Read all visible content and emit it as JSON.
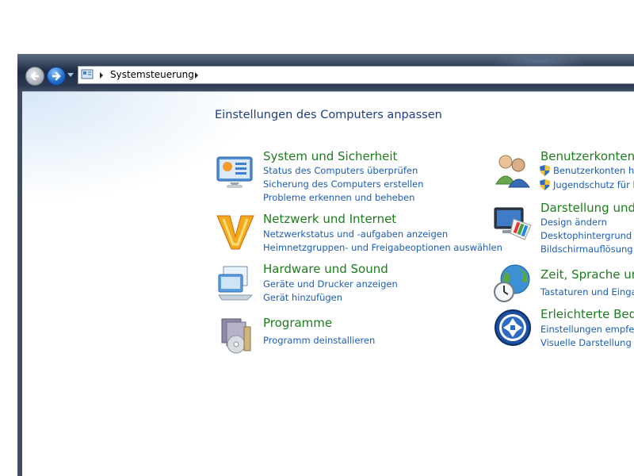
{
  "address": {
    "crumb": "Systemsteuerung"
  },
  "page": {
    "title": "Einstellungen des Computers anpassen"
  },
  "left": [
    {
      "title": "System und Sicherheit",
      "icon": "system-security-icon",
      "links": [
        "Status des Computers überprüfen",
        "Sicherung des Computers erstellen",
        "Probleme erkennen und beheben"
      ]
    },
    {
      "title": "Netzwerk und Internet",
      "icon": "network-internet-icon",
      "links": [
        "Netzwerkstatus und -aufgaben anzeigen",
        "Heimnetzgruppen- und Freigabeoptionen auswählen"
      ]
    },
    {
      "title": "Hardware und Sound",
      "icon": "hardware-sound-icon",
      "links": [
        "Geräte und Drucker anzeigen",
        "Gerät hinzufügen"
      ]
    },
    {
      "title": "Programme",
      "icon": "programs-icon",
      "links": [
        "Programm deinstallieren"
      ]
    }
  ],
  "right": [
    {
      "title": "Benutzerkonten u",
      "icon": "user-accounts-icon",
      "links": [
        "Benutzerkonten hin",
        "Jugendschutz für be"
      ]
    },
    {
      "title": "Darstellung und A",
      "icon": "appearance-icon",
      "links": [
        "Design ändern",
        "Desktophintergrund än",
        "Bildschirmauflösung a"
      ]
    },
    {
      "title": "Zeit, Sprache und",
      "icon": "clock-language-icon",
      "links": [
        "Tastaturen und Eingab"
      ]
    },
    {
      "title": "Erleichterte Bedie",
      "icon": "ease-of-access-icon",
      "links": [
        "Einstellungen empfehl",
        "Visuelle Darstellung de"
      ]
    }
  ],
  "colors": {
    "title": "#1e3f82",
    "category": "#1d7d1d",
    "link": "#1c5cb8"
  }
}
